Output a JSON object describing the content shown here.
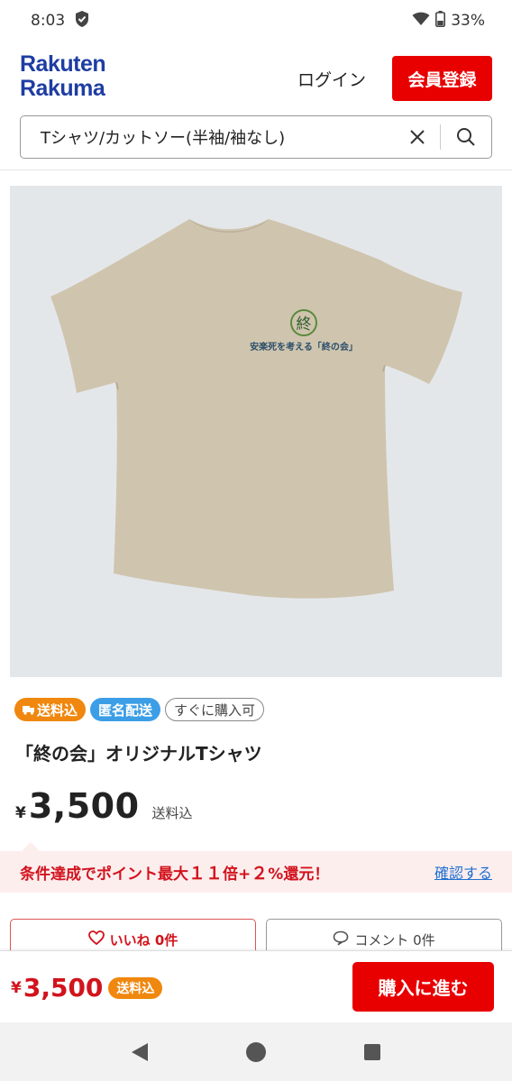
{
  "status_bar": {
    "time": "8:03",
    "battery": "33%",
    "icons": [
      "shield-icon",
      "wifi-icon",
      "battery-icon"
    ]
  },
  "header": {
    "logo_line1": "Rakuten",
    "logo_line2": "Rakuma",
    "login_label": "ログイン",
    "register_label": "会員登録"
  },
  "search": {
    "value": "Tシャツ/カットソー(半袖/袖なし)",
    "icons": [
      "close-icon",
      "search-icon"
    ]
  },
  "product": {
    "image_print_text": "安楽死を考える「終の会」",
    "image_logo_char": "終",
    "badges": [
      "送料込",
      "匿名配送",
      "すぐに購入可"
    ],
    "title": "「終の会」オリジナルTシャツ",
    "currency": "¥",
    "price": "3,500",
    "price_note": "送料込"
  },
  "point_banner": {
    "text_a": "条件達成でポイント最大",
    "text_b": "１１",
    "text_c": "倍+",
    "text_d": "２",
    "text_e": "%還元！",
    "link": "確認する"
  },
  "actions": {
    "like_label": "いいね 0件",
    "comment_label": "コメント 0件"
  },
  "bottom_bar": {
    "currency": "¥",
    "price": "3,500",
    "badge": "送料込",
    "buy_label": "購入に進む"
  },
  "colors": {
    "brand_red": "#e80000",
    "logo_blue": "#1e3da3",
    "shipping_orange": "#f0870e",
    "anon_blue": "#3c9ee6",
    "shirt_beige": "#cfc4ae"
  }
}
